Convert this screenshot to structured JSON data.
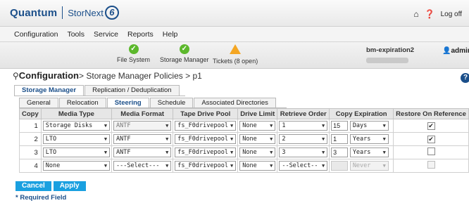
{
  "app": {
    "brand": "Quantum",
    "product": "StorNext",
    "version_badge": "6"
  },
  "top_right": {
    "logoff_label": "Log off"
  },
  "menu": [
    "Configuration",
    "Tools",
    "Service",
    "Reports",
    "Help"
  ],
  "status": {
    "file_system": "File System",
    "storage_manager": "Storage Manager",
    "tickets": "Tickets (8 open)",
    "server_name": "bm-expiration2",
    "user": "admin"
  },
  "page": {
    "title_bold": "Configuration",
    "title_rest": "> Storage Manager Policies > p1"
  },
  "tabs_top": [
    "Storage Manager",
    "Replication / Deduplication"
  ],
  "tabs_sub": [
    "General",
    "Relocation",
    "Steering",
    "Schedule",
    "Associated Directories"
  ],
  "table": {
    "headers": [
      "Copy",
      "Media Type",
      "Media Format",
      "Tape Drive Pool",
      "Drive Limit",
      "Retrieve Order",
      "Copy Expiration",
      "Restore On Reference"
    ],
    "rows": [
      {
        "copy": "1",
        "media_type": "Storage Disks",
        "media_format": "ANTF",
        "pool": "fs_F0drivepool",
        "limit": "None",
        "retrieve": "1",
        "exp_num": "15",
        "exp_unit": "Days",
        "restore": "✔"
      },
      {
        "copy": "2",
        "media_type": "LTO",
        "media_format": "ANTF",
        "pool": "fs_F0drivepool",
        "limit": "None",
        "retrieve": "2",
        "exp_num": "1",
        "exp_unit": "Years",
        "restore": "✔"
      },
      {
        "copy": "3",
        "media_type": "LTO",
        "media_format": "ANTF",
        "pool": "fs_F0drivepool",
        "limit": "None",
        "retrieve": "3",
        "exp_num": "3",
        "exp_unit": "Years",
        "restore": ""
      },
      {
        "copy": "4",
        "media_type": "None",
        "media_format": "---Select---",
        "pool": "fs_F0drivepool",
        "limit": "None",
        "retrieve": "--Select--",
        "exp_num": "",
        "exp_unit": "Never",
        "restore": ""
      }
    ]
  },
  "buttons": {
    "cancel": "Cancel",
    "apply": "Apply"
  },
  "required_note": "* Required Field",
  "colors": {
    "brand": "#1b4f8a",
    "ok": "#5cb82c",
    "warn": "#f4a623",
    "button": "#1aa0e0"
  }
}
